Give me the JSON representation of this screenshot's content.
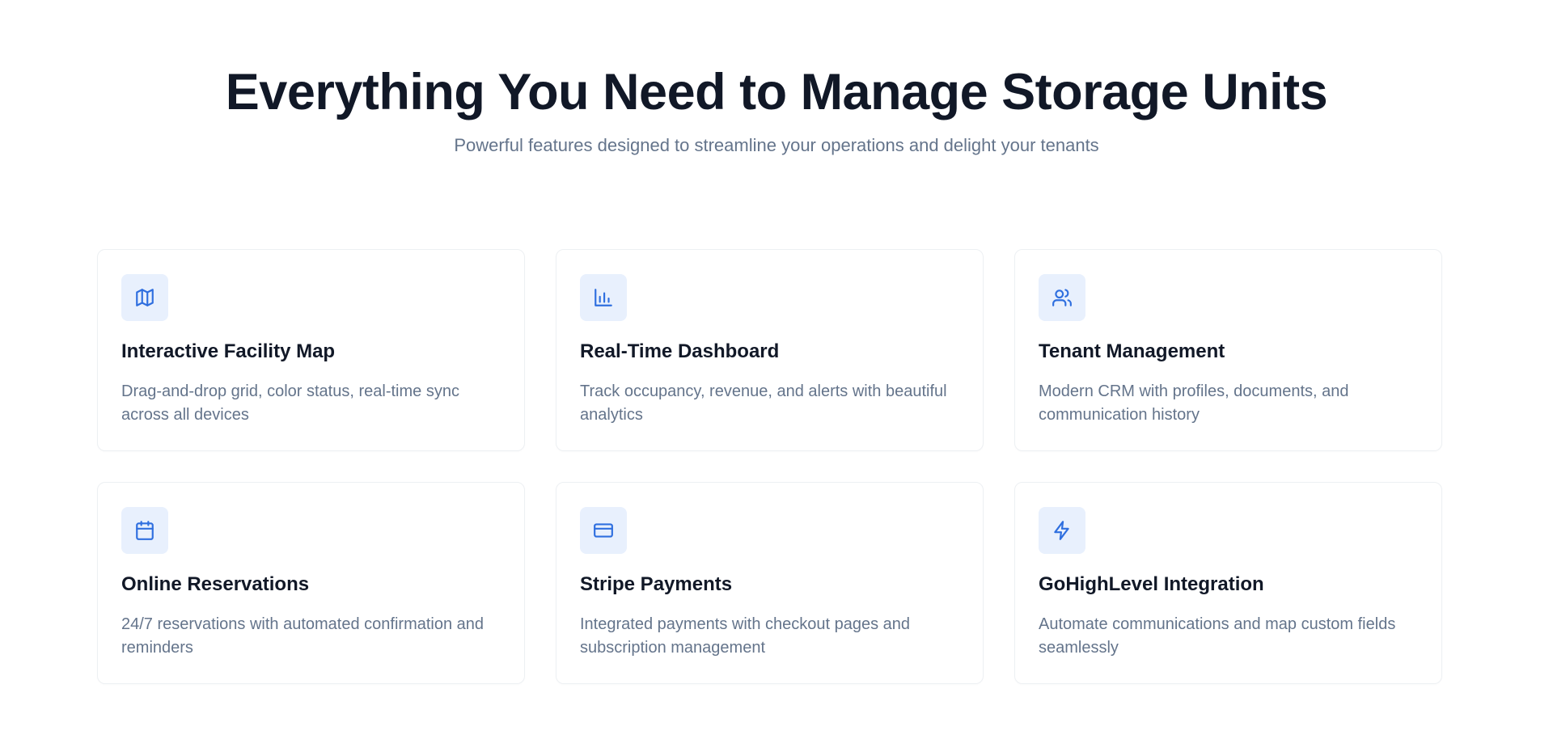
{
  "hero": {
    "title": "Everything You Need to Manage Storage Units",
    "subtitle": "Powerful features designed to streamline your operations and delight your tenants"
  },
  "accent_color": "#2f6fdf",
  "icon_bg_color": "#e8f0fd",
  "features": [
    {
      "icon": "map-icon",
      "title": "Interactive Facility Map",
      "description": "Drag-and-drop grid, color status, real-time sync across all devices"
    },
    {
      "icon": "bar-chart-icon",
      "title": "Real-Time Dashboard",
      "description": "Track occupancy, revenue, and alerts with beautiful analytics"
    },
    {
      "icon": "users-icon",
      "title": "Tenant Management",
      "description": "Modern CRM with profiles, documents, and communication history"
    },
    {
      "icon": "calendar-icon",
      "title": "Online Reservations",
      "description": "24/7 reservations with automated confirmation and reminders"
    },
    {
      "icon": "credit-card-icon",
      "title": "Stripe Payments",
      "description": "Integrated payments with checkout pages and subscription management"
    },
    {
      "icon": "lightning-icon",
      "title": "GoHighLevel Integration",
      "description": "Automate communications and map custom fields seamlessly"
    }
  ]
}
